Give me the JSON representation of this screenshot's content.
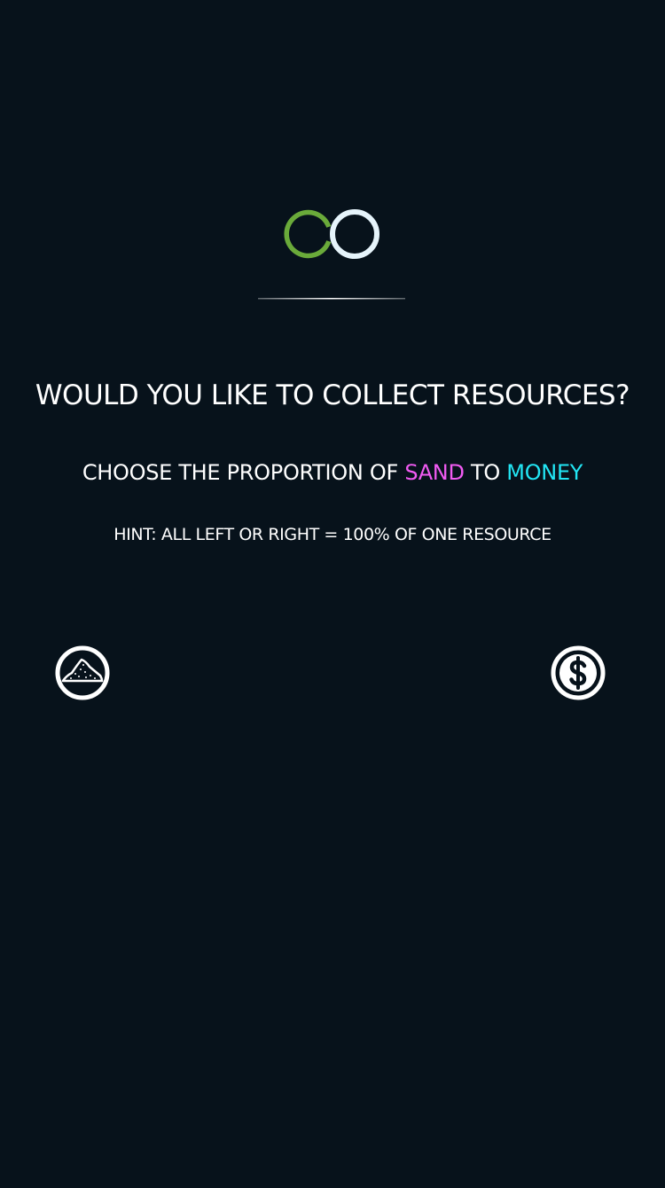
{
  "logo": {
    "icon": "co-logo-icon",
    "colors": {
      "c": "#6aaa3a",
      "o": "#e6f4fb"
    }
  },
  "prompt": {
    "title": "WOULD YOU LIKE TO COLLECT RESOURCES?",
    "choose_prefix": "CHOOSE THE PROPORTION OF",
    "sand_label": "SAND",
    "connector": "TO",
    "money_label": "MONEY",
    "hint": "HINT: ALL LEFT OR RIGHT = 100% OF ONE RESOURCE"
  },
  "resources": {
    "left": {
      "icon": "sand-pile-icon"
    },
    "right": {
      "icon": "dollar-icon"
    }
  },
  "colors": {
    "background": "#07121b",
    "text": "#ffffff",
    "sand_accent": "#f15bf2",
    "money_accent": "#22e6f4"
  }
}
